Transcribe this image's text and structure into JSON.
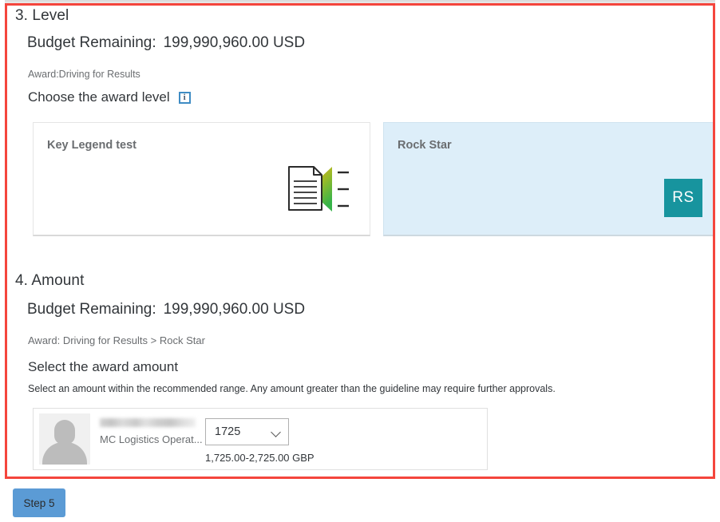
{
  "level_section": {
    "step_title": "3. Level",
    "budget_label": "Budget Remaining:",
    "budget_value": "199,990,960.00 USD",
    "award_breadcrumb": "Award:Driving for Results",
    "choose_label": "Choose the award level",
    "info_icon_glyph": "i",
    "cards": [
      {
        "title": "Key Legend test",
        "icon": "document-arrow-icon",
        "selected": false
      },
      {
        "title": "Rock Star",
        "badge_initials": "RS",
        "selected": true
      }
    ]
  },
  "amount_section": {
    "step_title": "4. Amount",
    "budget_label": "Budget Remaining:",
    "budget_value": "199,990,960.00 USD",
    "award_breadcrumb": "Award: Driving for Results > Rock Star",
    "select_heading": "Select the award amount",
    "helper_text": "Select an amount within the recommended range. Any amount greater than the guideline may require further approvals.",
    "recipient": {
      "name_redacted": "█████████ ████████",
      "role": "MC Logistics Operat...",
      "amount_value": "1725",
      "amount_range": "1,725.00-2,725.00 GBP"
    }
  },
  "footer": {
    "step_button_label": "Step 5"
  },
  "colors": {
    "highlight_border": "#f4453c",
    "selected_card_bg": "#ddeef9",
    "badge_teal": "#17949e",
    "button_blue": "#5b9bd5",
    "info_blue": "#3f8cc4"
  }
}
